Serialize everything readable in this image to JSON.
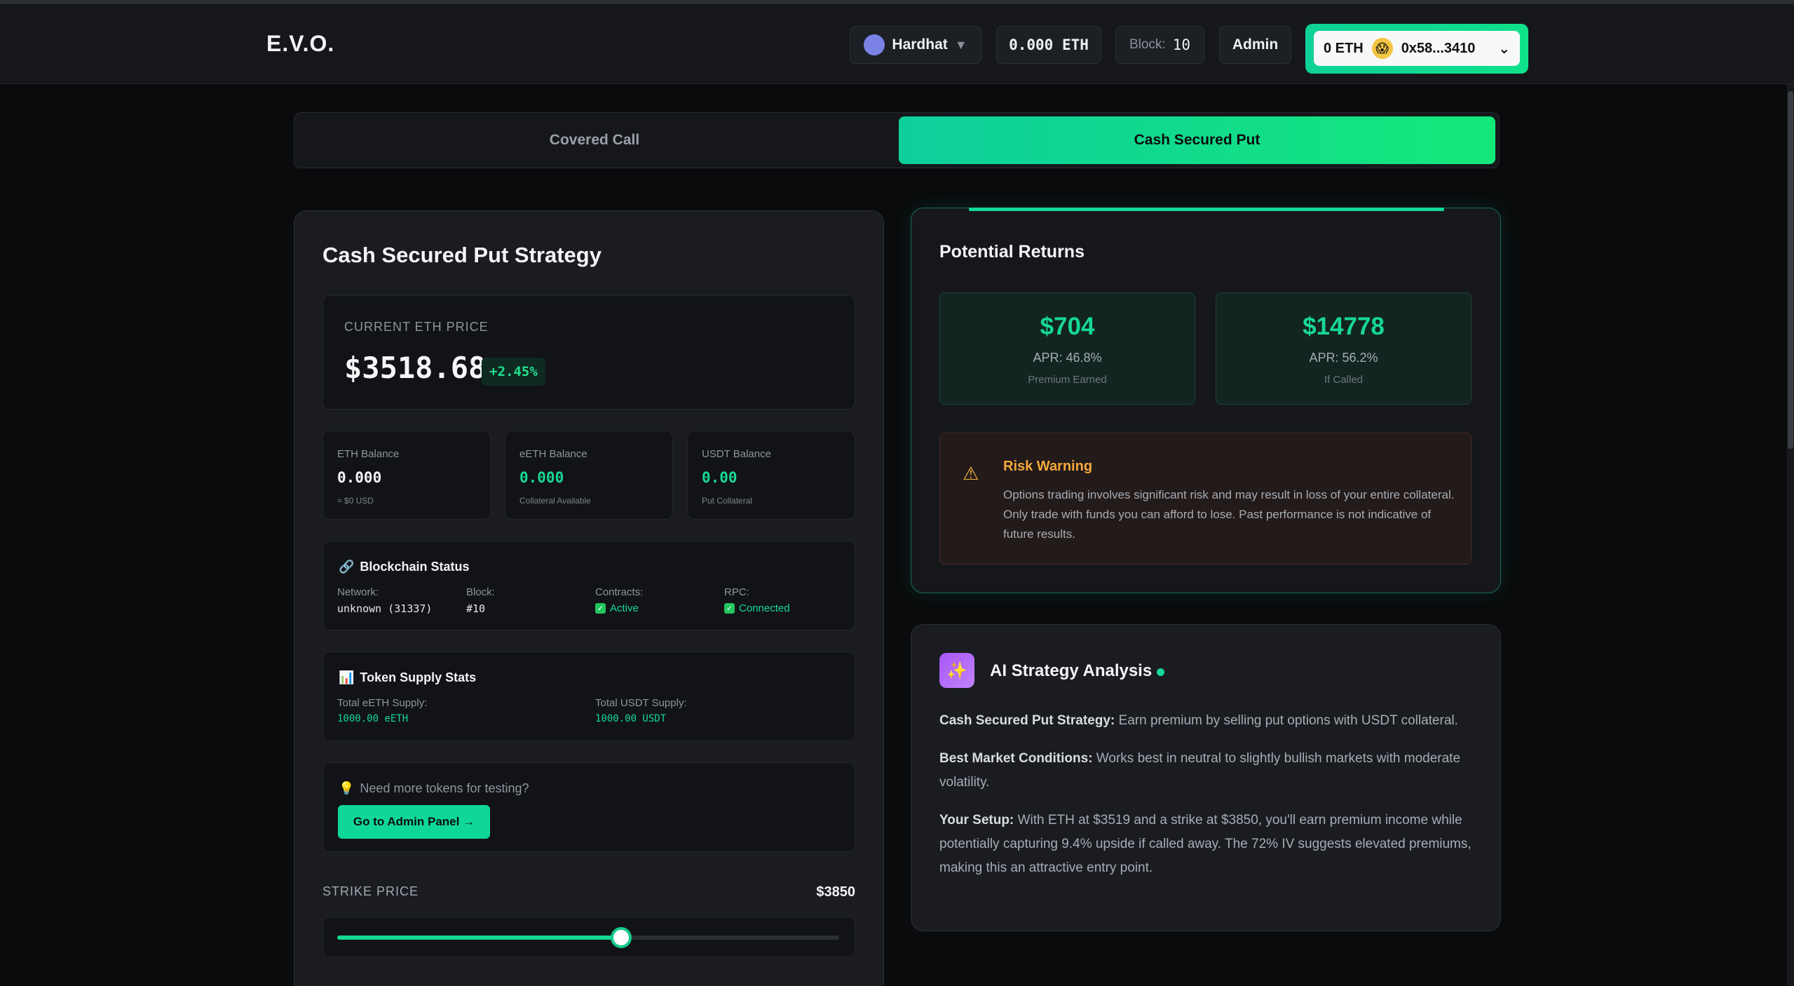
{
  "header": {
    "logo": "E.V.O.",
    "network": "Hardhat",
    "eth_balance": "0.000 ETH",
    "block_label": "Block:",
    "block_value": "10",
    "admin": "Admin",
    "wallet_balance": "0 ETH",
    "wallet_address": "0x58...3410"
  },
  "tabs": [
    {
      "label": "Covered Call",
      "active": false
    },
    {
      "label": "Cash Secured Put",
      "active": true
    }
  ],
  "strategy": {
    "title": "Cash Secured Put Strategy",
    "price_label": "CURRENT ETH PRICE",
    "price": "$3518.68",
    "change": "+2.45%"
  },
  "balances": [
    {
      "label": "ETH Balance",
      "value": "0.000",
      "sub": "≈ $0 USD"
    },
    {
      "label": "eETH Balance",
      "value": "0.000",
      "sub": "Collateral Available"
    },
    {
      "label": "USDT Balance",
      "value": "0.00",
      "sub": "Put Collateral"
    }
  ],
  "blockchain": {
    "title": "Blockchain Status",
    "network_k": "Network:",
    "network_v": "unknown (31337)",
    "block_k": "Block:",
    "block_v": "#10",
    "contracts_k": "Contracts:",
    "contracts_v": "Active",
    "rpc_k": "RPC:",
    "rpc_v": "Connected"
  },
  "supply": {
    "title": "Token Supply Stats",
    "eeth_k": "Total eETH Supply:",
    "eeth_v": "1000.00 eETH",
    "usdt_k": "Total USDT Supply:",
    "usdt_v": "1000.00 USDT"
  },
  "tokens": {
    "question": "Need more tokens for testing?",
    "button": "Go to Admin Panel →"
  },
  "strike": {
    "label": "STRIKE PRICE",
    "value": "$3850",
    "slider_fraction": 0.565
  },
  "returns": {
    "title": "Potential Returns",
    "cards": [
      {
        "value": "$704",
        "apr": "APR: 46.8%",
        "sub": "Premium Earned"
      },
      {
        "value": "$14778",
        "apr": "APR: 56.2%",
        "sub": "If Called"
      }
    ],
    "risk_title": "Risk Warning",
    "risk_text": "Options trading involves significant risk and may result in loss of your entire collateral. Only trade with funds you can afford to lose. Past performance is not indicative of future results."
  },
  "ai": {
    "title": "AI Strategy Analysis",
    "p1_bold": "Cash Secured Put Strategy:",
    "p1": " Earn premium by selling put options with USDT collateral.",
    "p2_bold": "Best Market Conditions:",
    "p2": " Works best in neutral to slightly bullish markets with moderate volatility.",
    "p3_bold": "Your Setup:",
    "p3": " With ETH at $3519 and a strike at $3850, you'll earn premium income while potentially capturing 9.4% upside if called away. The 72% IV suggests elevated premiums, making this an attractive entry point."
  },
  "colors": {
    "accent": "#17d896",
    "warning": "#f4a93b",
    "background": "#0a0b0d"
  }
}
